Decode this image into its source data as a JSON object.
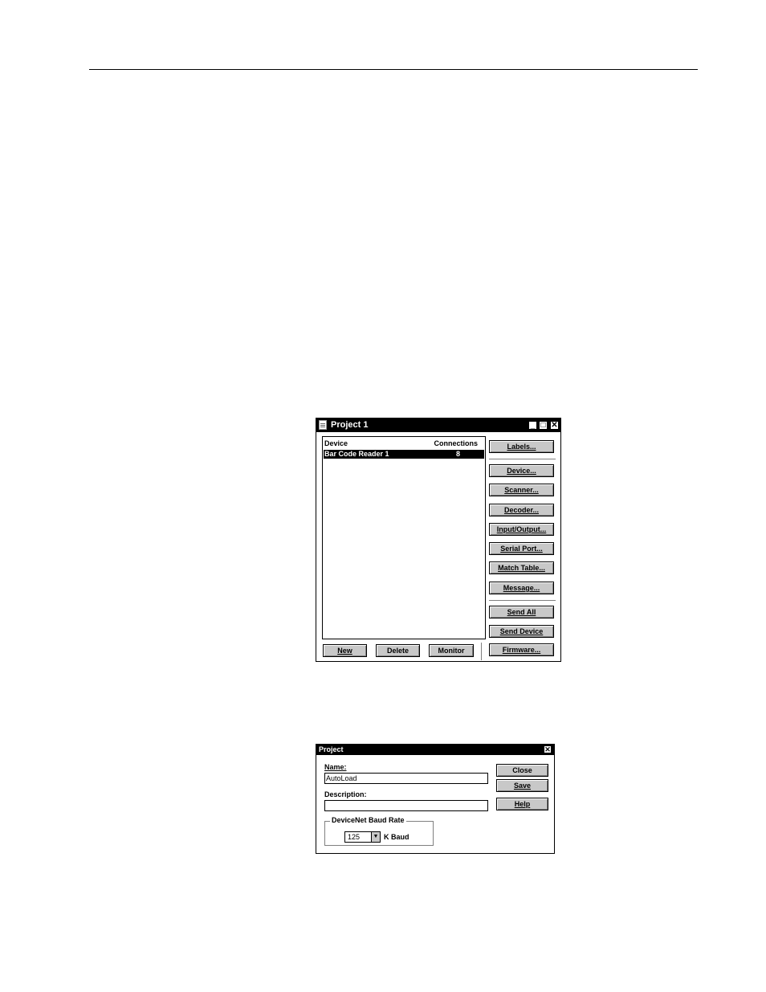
{
  "project_window": {
    "title": "Project 1",
    "list": {
      "headers": {
        "device": "Device",
        "connections": "Connections"
      },
      "rows": [
        {
          "device": "Bar Code Reader 1",
          "connections": "8"
        }
      ]
    },
    "side_buttons": {
      "labels": "Labels...",
      "device": "Device...",
      "scanner": "Scanner...",
      "decoder": "Decoder...",
      "input_output": "Input/Output...",
      "serial_port": "Serial Port...",
      "match_table": "Match Table...",
      "message": "Message...",
      "send_all": "Send All",
      "send_device": "Send Device",
      "firmware": "Firmware..."
    },
    "bottom_buttons": {
      "new": "New",
      "delete": "Delete",
      "monitor": "Monitor"
    },
    "controls": {
      "minimize": "_",
      "maximize": "□",
      "close": "✕"
    }
  },
  "project_dialog": {
    "title": "Project",
    "name_label": "Name:",
    "name_value": "AutoLoad",
    "description_label": "Description:",
    "description_value": "",
    "baud_group_label": "DeviceNet Baud Rate",
    "baud_value": "125",
    "baud_unit": "K Baud",
    "buttons": {
      "close": "Close",
      "save": "Save",
      "help": "Help"
    },
    "controls": {
      "close": "✕"
    }
  }
}
